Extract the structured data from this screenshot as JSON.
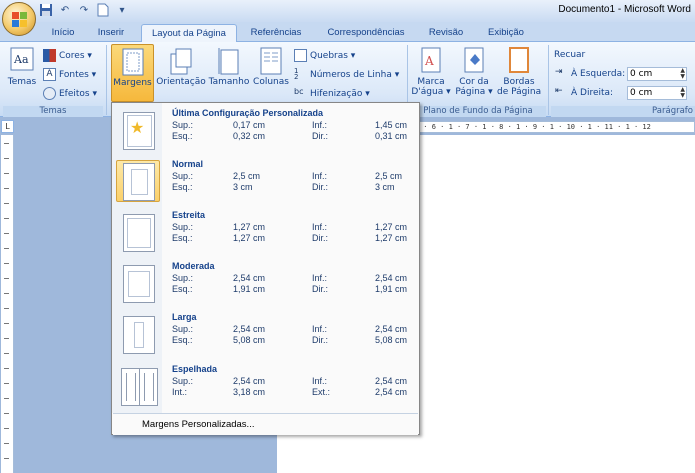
{
  "window": {
    "title": "Documento1 - Microsoft Word"
  },
  "qat": {
    "save": "save-icon",
    "undo": "undo-icon",
    "redo": "redo-icon",
    "new": "new-document-icon",
    "more": "▾"
  },
  "tabs": [
    "Início",
    "Inserir",
    "Layout da Página",
    "Referências",
    "Correspondências",
    "Revisão",
    "Exibição"
  ],
  "ribbon": {
    "temas": {
      "label": "Temas",
      "themes_btn": "Temas",
      "cores": "Cores ▾",
      "fontes": "Fontes ▾",
      "efeitos": "Efeitos ▾"
    },
    "config": {
      "margens": "Margens",
      "orientacao": "Orientação",
      "tamanho": "Tamanho",
      "colunas": "Colunas",
      "quebras": "Quebras ▾",
      "numeros": "Números de Linha ▾",
      "hifenizacao": "Hifenização ▾"
    },
    "fundo": {
      "label": "Plano de Fundo da Página",
      "marca1": "Marca",
      "marca2": "D'água ▾",
      "cor1": "Cor da",
      "cor2": "Página ▾",
      "bordas1": "Bordas",
      "bordas2": "de Página"
    },
    "paragrafo": {
      "label": "Parágrafo",
      "recuar": "Recuar",
      "esquerda": "À Esquerda:",
      "esquerda_val": "0 cm",
      "direita": "À Direita:",
      "direita_val": "0 cm"
    }
  },
  "ruler": {
    "marks": "1 · 2 · 1 · 3 · 1 · 4 · 1 · 5 · 1 · 6 · 1 · 7 · 1 · 8 · 1 · 9 · 1 · 10 · 1 · 11 · 1 · 12"
  },
  "margins_menu": {
    "items": [
      {
        "name": "Última Configuração Personalizada",
        "k1": "Sup.:",
        "v1": "0,17 cm",
        "k2": "Inf.:",
        "v2": "1,45 cm",
        "k3": "Esq.:",
        "v3": "0,32 cm",
        "k4": "Dir.:",
        "v4": "0,31 cm",
        "selected": false
      },
      {
        "name": "Normal",
        "k1": "Sup.:",
        "v1": "2,5 cm",
        "k2": "Inf.:",
        "v2": "2,5 cm",
        "k3": "Esq.:",
        "v3": "3 cm",
        "k4": "Dir.:",
        "v4": "3 cm",
        "selected": true
      },
      {
        "name": "Estreita",
        "k1": "Sup.:",
        "v1": "1,27 cm",
        "k2": "Inf.:",
        "v2": "1,27 cm",
        "k3": "Esq.:",
        "v3": "1,27 cm",
        "k4": "Dir.:",
        "v4": "1,27 cm",
        "selected": false
      },
      {
        "name": "Moderada",
        "k1": "Sup.:",
        "v1": "2,54 cm",
        "k2": "Inf.:",
        "v2": "2,54 cm",
        "k3": "Esq.:",
        "v3": "1,91 cm",
        "k4": "Dir.:",
        "v4": "1,91 cm",
        "selected": false
      },
      {
        "name": "Larga",
        "k1": "Sup.:",
        "v1": "2,54 cm",
        "k2": "Inf.:",
        "v2": "2,54 cm",
        "k3": "Esq.:",
        "v3": "5,08 cm",
        "k4": "Dir.:",
        "v4": "5,08 cm",
        "selected": false
      },
      {
        "name": "Espelhada",
        "k1": "Sup.:",
        "v1": "2,54 cm",
        "k2": "Inf.:",
        "v2": "2,54 cm",
        "k3": "Int.:",
        "v3": "3,18 cm",
        "k4": "Ext.:",
        "v4": "2,54 cm",
        "selected": false
      }
    ],
    "custom": "Margens Personalizadas..."
  },
  "colors": {
    "accent": "#15428b",
    "selected": "#fbd06a",
    "ribbon": "#dbe8f8"
  }
}
